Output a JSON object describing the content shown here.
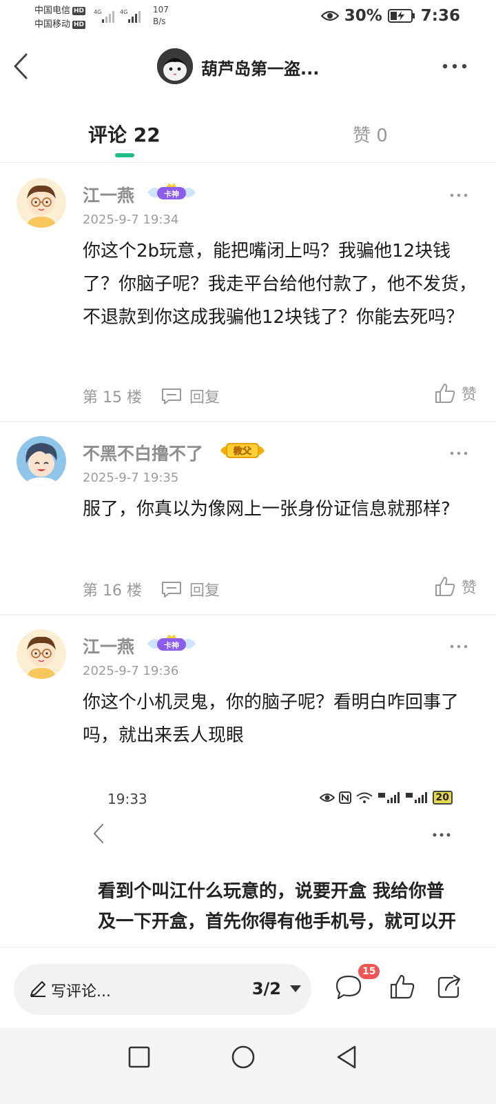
{
  "status_bar": {
    "carrier_1": "中国电信",
    "carrier_2": "中国移动",
    "hd_label": "HD",
    "net_speed_value": "107",
    "net_speed_unit": "B/s",
    "battery": "30%",
    "time": "7:36"
  },
  "header": {
    "title": "葫芦岛第一盗...",
    "back_icon": "chevron-left-icon",
    "more_icon": "more-horizontal-icon"
  },
  "tabs": {
    "comments": "评论 22",
    "likes": "赞 0",
    "accent_color": "#1fbd8a"
  },
  "comments": [
    {
      "name": "江一燕",
      "badge": "卡神",
      "time": "2025-9-7 19:34",
      "text": "你这个2b玩意，能把嘴闭上吗？我骗他12块钱了？你脑子呢？我走平台给他付款了，他不发货，不退款到你这成我骗他12块钱了？你能去死吗？",
      "floor": "第 15 楼",
      "reply": "回复",
      "like": "赞"
    },
    {
      "name": "不黑不白撸不了",
      "badge": "教父",
      "time": "2025-9-7 19:35",
      "text": "服了，你真以为像网上一张身份证信息就那样?",
      "floor": "第 16 楼",
      "reply": "回复",
      "like": "赞"
    },
    {
      "name": "江一燕",
      "badge": "卡神",
      "time": "2025-9-7 19:36",
      "text": "你这个小机灵鬼，你的脑子呢？看明白咋回事了吗，就出来丢人现眼"
    }
  ],
  "embedded_screenshot": {
    "time": "19:33",
    "battery": "20",
    "text": "看到个叫江什么玩意的，说要开盒 我给你普及一下开盒，首先你得有他手机号，就可以开"
  },
  "bottom_bar": {
    "placeholder": "写评论...",
    "page_indicator": "3/2",
    "comment_count": "15"
  },
  "nav_bar": {
    "buttons": [
      "square-recent-icon",
      "circle-home-icon",
      "triangle-back-icon"
    ]
  }
}
